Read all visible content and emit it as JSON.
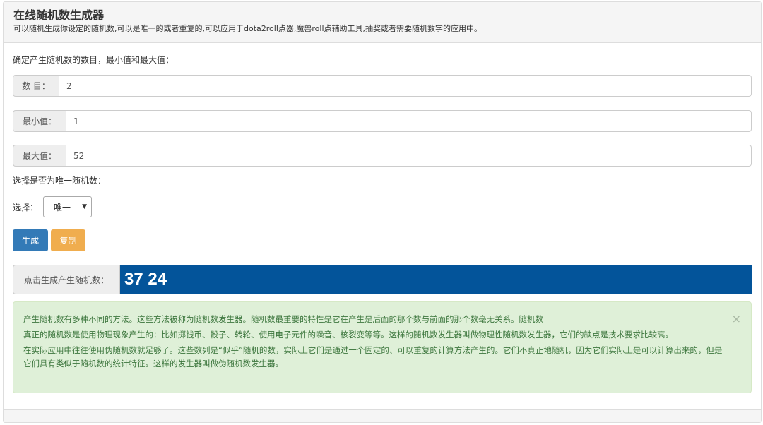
{
  "header": {
    "title": "在线随机数生成器",
    "subtitle": "可以随机生成你设定的随机数,可以是唯一的或者重复的,可以应用于dota2roll点器,魔兽roll点辅助工具,抽奖或者需要随机数字的应用中。"
  },
  "form": {
    "intro": "确定产生随机数的数目，最小值和最大值：",
    "count": {
      "label": "数 目：",
      "value": "2"
    },
    "min": {
      "label": "最小值：",
      "value": "1"
    },
    "max": {
      "label": "最大值：",
      "value": "52"
    },
    "unique_prompt": "选择是否为唯一随机数：",
    "select_label": "选择：",
    "select_value": "唯一",
    "generate_label": "生成",
    "copy_label": "复制"
  },
  "result": {
    "label": "点击生成产生随机数：",
    "value": "37 24"
  },
  "info": {
    "paragraphs": [
      "产生随机数有多种不同的方法。这些方法被称为随机数发生器。随机数最重要的特性是它在产生是后面的那个数与前面的那个数毫无关系。随机数",
      "真正的随机数是使用物理现象产生的：比如掷钱币、骰子、转轮、使用电子元件的噪音、核裂变等等。这样的随机数发生器叫做物理性随机数发生器，它们的缺点是技术要求比较高。",
      "在实际应用中往往使用伪随机数就足够了。这些数列是“似乎”随机的数，实际上它们是通过一个固定的、可以重复的计算方法产生的。它们不真正地随机，因为它们实际上是可以计算出来的，但是它们具有类似于随机数的统计特征。这样的发生器叫做伪随机数发生器。"
    ],
    "close": "×"
  },
  "colors": {
    "primary": "#337ab7",
    "warning": "#f0ad4e",
    "result_bg": "#03549a",
    "success_bg": "#dff0d8"
  }
}
